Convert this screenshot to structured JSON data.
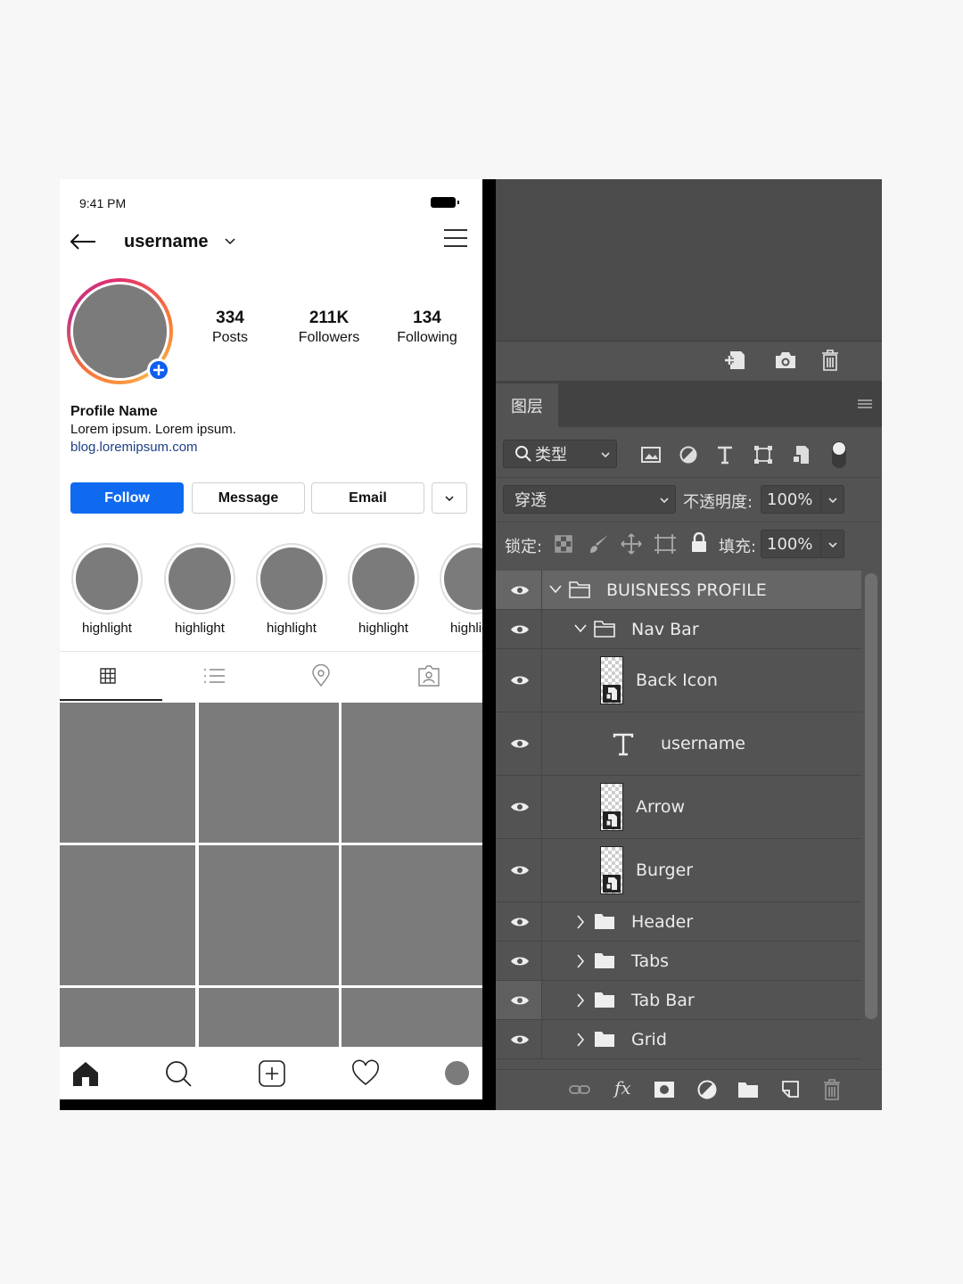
{
  "phone": {
    "status_time": "9:41 PM",
    "nav": {
      "username": "username"
    },
    "stats": [
      {
        "value": "334",
        "label": "Posts"
      },
      {
        "value": "211K",
        "label": "Followers"
      },
      {
        "value": "134",
        "label": "Following"
      }
    ],
    "profile": {
      "name": "Profile Name",
      "bio": "Lorem ipsum. Lorem ipsum.",
      "link": "blog.loremipsum.com"
    },
    "buttons": {
      "follow": "Follow",
      "message": "Message",
      "email": "Email"
    },
    "highlights": [
      "highlight",
      "highlight",
      "highlight",
      "highlight",
      "highlight"
    ],
    "tabs": [
      "grid-icon",
      "list-icon",
      "location-pin-icon",
      "tagged-user-icon"
    ],
    "bottom_nav": [
      "home-icon",
      "search-icon",
      "add-post-icon",
      "heart-icon",
      "profile-avatar"
    ],
    "colors": {
      "follow_button": "#0f6af0",
      "link": "#1d3f86",
      "placeholder_gray": "#7b7b7b"
    }
  },
  "photoshop": {
    "panel_tab": "图层",
    "filter": {
      "label": "类型"
    },
    "blend_mode": "穿透",
    "opacity_label": "不透明度:",
    "opacity_value": "100%",
    "lock_label": "锁定:",
    "fill_label": "填充:",
    "fill_value": "100%",
    "layers": [
      {
        "name": "BUISNESS PROFILE",
        "type": "group",
        "expanded": true,
        "selected": true
      },
      {
        "name": "Nav Bar",
        "type": "group",
        "expanded": true
      },
      {
        "name": "Back Icon",
        "type": "smart-object"
      },
      {
        "name": "username",
        "type": "text"
      },
      {
        "name": "Arrow",
        "type": "smart-object"
      },
      {
        "name": "Burger",
        "type": "smart-object"
      },
      {
        "name": "Header",
        "type": "group",
        "expanded": false
      },
      {
        "name": "Tabs",
        "type": "group",
        "expanded": false
      },
      {
        "name": "Tab Bar",
        "type": "group",
        "expanded": false
      },
      {
        "name": "Grid",
        "type": "group",
        "expanded": false
      }
    ],
    "footer_icons": [
      "link-icon",
      "fx-icon",
      "mask-icon",
      "adjustment-icon",
      "folder-icon",
      "new-layer-icon",
      "trash-icon"
    ],
    "footer_fx_label": "fx",
    "colors": {
      "panel_bg": "#535353",
      "selected_row": "#666666"
    }
  }
}
